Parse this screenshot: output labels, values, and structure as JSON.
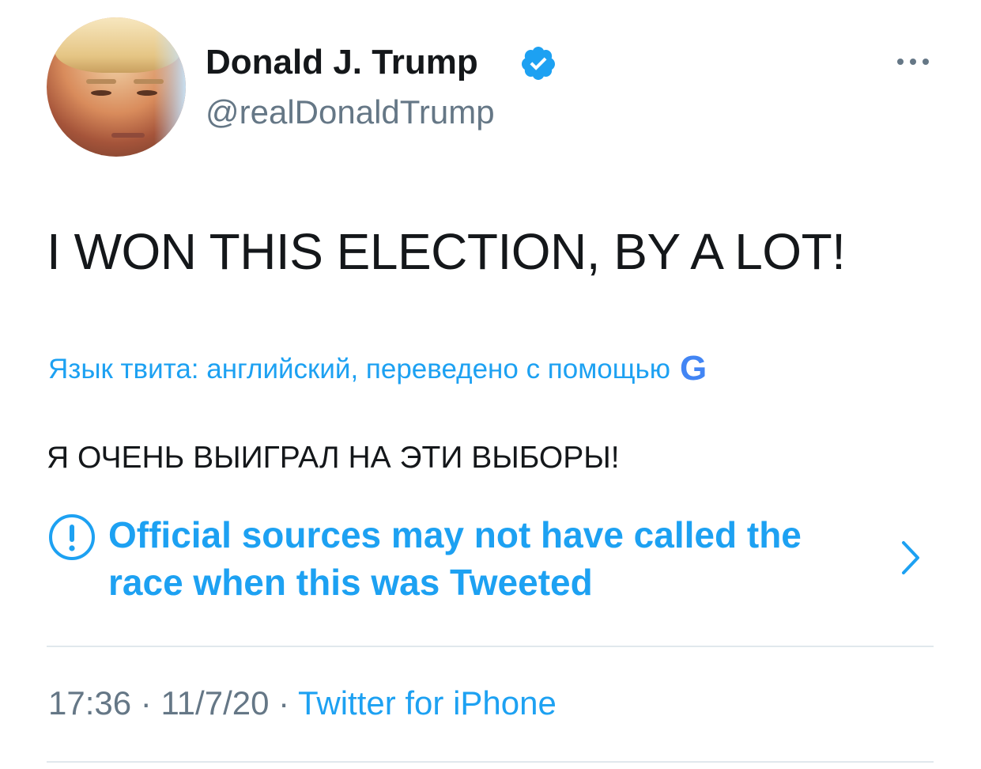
{
  "author": {
    "name": "Donald J. Trump",
    "handle": "@realDonaldTrump",
    "verified": true
  },
  "tweet": {
    "text": "I WON THIS ELECTION, BY A LOT!"
  },
  "translation": {
    "label": "Язык твита: английский, переведено с помощью",
    "provider_glyph": "G",
    "text": "Я ОЧЕНЬ ВЫИГРАЛ НА ЭТИ ВЫБОРЫ!"
  },
  "notice": {
    "text": "Official sources may not have called the race when this was Tweeted"
  },
  "meta": {
    "time": "17:36",
    "separator": " · ",
    "date": "11/7/20",
    "source": "Twitter for iPhone"
  },
  "colors": {
    "accent": "#1da1f2",
    "text": "#14171a",
    "muted": "#657786",
    "divider": "#e1e8ed"
  },
  "icons": {
    "verified": "verified-badge-icon",
    "more": "more-options-icon",
    "info": "exclamation-circle-icon",
    "chevron": "chevron-right-icon"
  }
}
